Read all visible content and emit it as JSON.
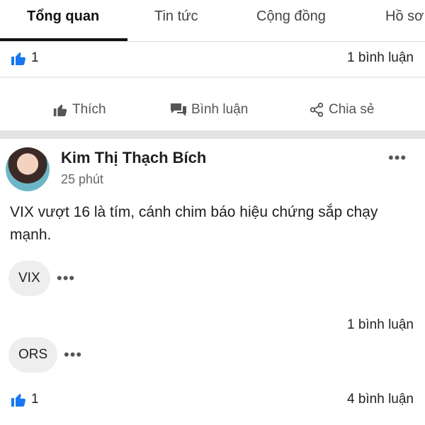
{
  "tabs": [
    "Tổng quan",
    "Tin tức",
    "Cộng đồng",
    "Hồ sơ"
  ],
  "top_post": {
    "likes": "1",
    "comments": "1 bình luận"
  },
  "actions": {
    "like": "Thích",
    "comment": "Bình luận",
    "share": "Chia sẻ"
  },
  "post": {
    "author": "Kim Thị Thạch Bích",
    "time": "25 phút",
    "text": "VIX vượt 16 là tím, cánh chim báo hiệu chứng sắp chạy mạnh.",
    "more": "•••"
  },
  "tags": [
    {
      "label": "VIX",
      "comments": "1 bình luận"
    },
    {
      "label": "ORS",
      "likes": "1",
      "comments": "4 bình luận"
    }
  ],
  "colors": {
    "like_blue": "#1877f2",
    "text": "#1c1e21",
    "muted": "#666666"
  }
}
